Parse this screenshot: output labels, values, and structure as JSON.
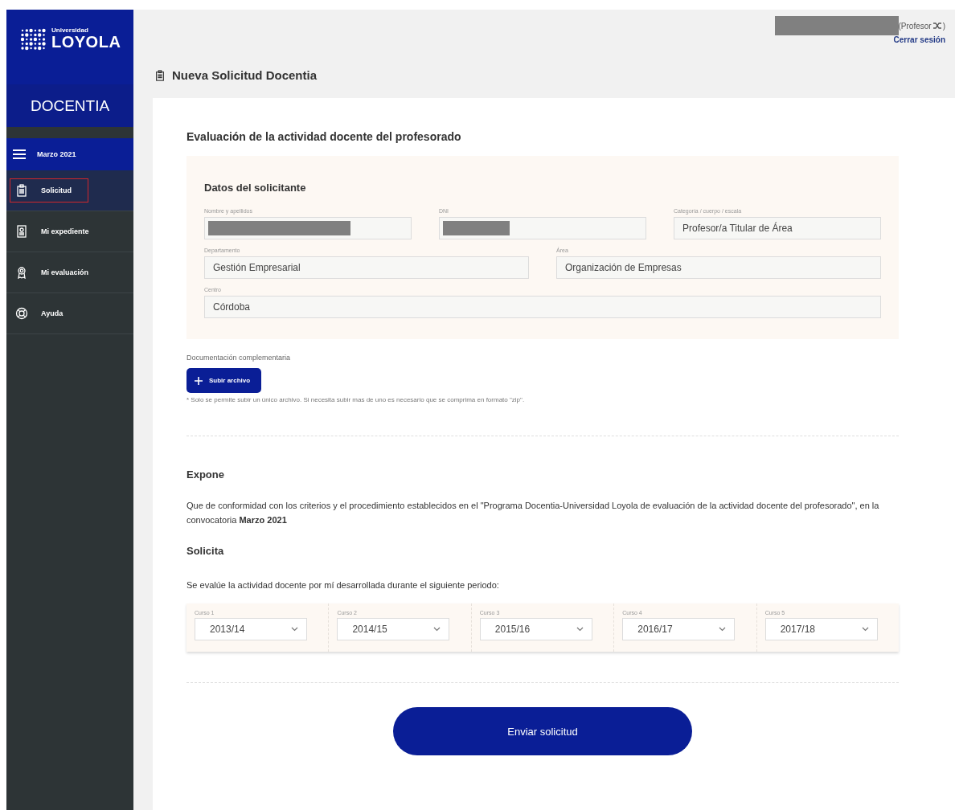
{
  "sidebar": {
    "logo": {
      "small": "Universidad",
      "big": "LOYOLA"
    },
    "app_name": "DOCENTIA",
    "period": "Marzo 2021",
    "items": [
      {
        "label": "Solicitud",
        "selected": true
      },
      {
        "label": "Mi expediente",
        "selected": false
      },
      {
        "label": "Mi evaluación",
        "selected": false
      },
      {
        "label": "Ayuda",
        "selected": false
      }
    ]
  },
  "user": {
    "role": "(Profesor",
    "role_end": ")",
    "logout": "Cerrar sesión"
  },
  "page_title": "Nueva Solicitud Docentia",
  "section_title": "Evaluación de la actividad docente del profesorado",
  "applicant": {
    "title": "Datos del solicitante",
    "rows": [
      [
        {
          "label": "Nombre y apellidos",
          "redacted": true
        },
        {
          "label": "DNI",
          "redacted": true
        },
        {
          "label": "Categoría / cuerpo / escala",
          "value": "Profesor/a Titular de Área"
        }
      ],
      [
        {
          "label": "Departamento",
          "value": "Gestión Empresarial"
        },
        {
          "label": "Área",
          "value": "Organización de Empresas"
        }
      ],
      [
        {
          "label": "Centro",
          "value": "Córdoba"
        }
      ]
    ]
  },
  "documents": {
    "label": "Documentación complementaria",
    "button": "Subir archivo",
    "note": "* Solo se permite subir un único archivo. Si necesita subir mas de uno es necesario que se comprima en formato \"zip\"."
  },
  "expone": {
    "title": "Expone",
    "text": "Que de conformidad con los criterios y el procedimiento establecidos en el \"Programa Docentia-Universidad Loyola de evaluación de la actividad docente del profesorado\", en la convocatoria **Marzo 2021**"
  },
  "solicita": {
    "title": "Solicita",
    "text": "Se evalúe la actividad docente por mí desarrollada durante el siguiente periodo:"
  },
  "courses": [
    {
      "label": "Curso 1",
      "value": "2013/14"
    },
    {
      "label": "Curso 2",
      "value": "2014/15"
    },
    {
      "label": "Curso 3",
      "value": "2015/16"
    },
    {
      "label": "Curso 4",
      "value": "2016/17"
    },
    {
      "label": "Curso 5",
      "value": "2017/18"
    }
  ],
  "submit": "Enviar solicitud"
}
